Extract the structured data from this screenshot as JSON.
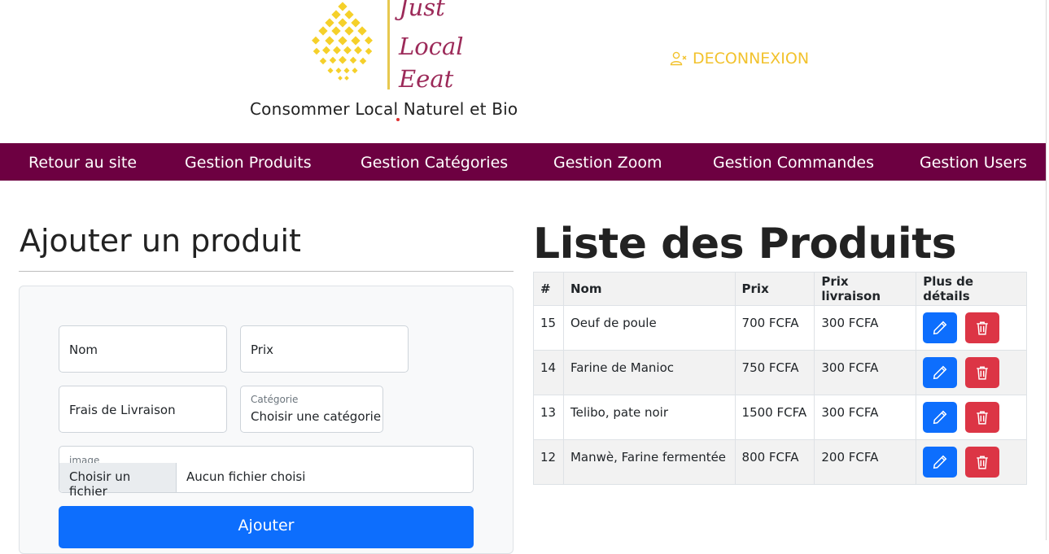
{
  "brand": {
    "words": [
      "Just",
      "Local",
      "Eeat"
    ],
    "tagline": "Consommer Local Naturel et Bio",
    "colors": {
      "petal": "#f5d02a",
      "wordmark": "#9c2a59"
    }
  },
  "header": {
    "logout_label": "DECONNEXION",
    "logout_icon": "user-remove-icon"
  },
  "nav": {
    "background": "#6d0041",
    "items": [
      {
        "label": "Retour au site"
      },
      {
        "label": "Gestion Produits"
      },
      {
        "label": "Gestion Catégories"
      },
      {
        "label": "Gestion Zoom"
      },
      {
        "label": "Gestion Commandes"
      },
      {
        "label": "Gestion Users"
      }
    ]
  },
  "form": {
    "title": "Ajouter un produit",
    "name_placeholder": "Nom",
    "price_placeholder": "Prix",
    "delivery_placeholder": "Frais de Livraison",
    "category_label": "Catégorie",
    "category_value": "Choisir une catégorie",
    "image_label": "image",
    "file_button": "Choisir un fichier",
    "file_status": "Aucun fichier choisi",
    "submit_label": "Ajouter"
  },
  "list": {
    "title": "Liste des Produits",
    "columns": [
      "#",
      "Nom",
      "Prix",
      "Prix livraison",
      "Plus de détails"
    ],
    "rows": [
      {
        "id": "15",
        "name": "Oeuf de poule",
        "price": "700 FCFA",
        "delivery": "300 FCFA"
      },
      {
        "id": "14",
        "name": "Farine de Manioc",
        "price": "750 FCFA",
        "delivery": "300 FCFA"
      },
      {
        "id": "13",
        "name": "Telibo, pate noir",
        "price": "1500 FCFA",
        "delivery": "300 FCFA"
      },
      {
        "id": "12",
        "name": "Manwè, Farine fermentée",
        "price": "800 FCFA",
        "delivery": "200 FCFA"
      }
    ],
    "actions": {
      "edit_icon": "pencil-icon",
      "delete_icon": "trash-icon",
      "edit_color": "#0d6efd",
      "delete_color": "#dc3545"
    }
  }
}
